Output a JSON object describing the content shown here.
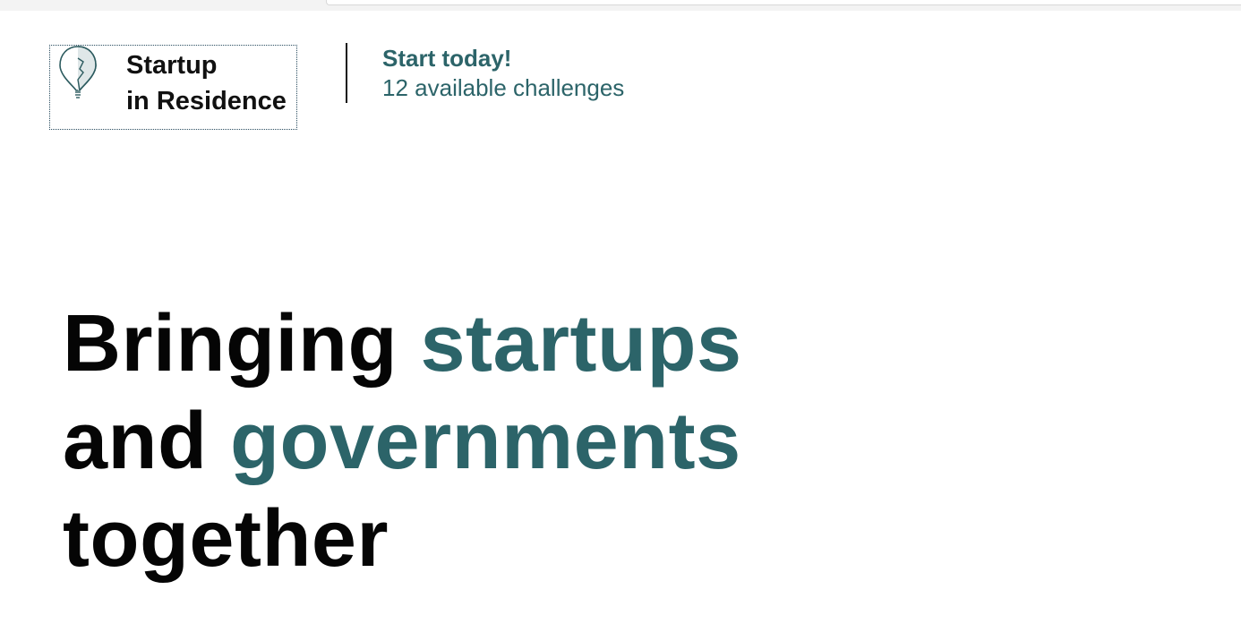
{
  "brand": {
    "line1": "Startup",
    "line2": "in Residence",
    "logo_icon": "lightbulb-icon"
  },
  "cta": {
    "title": "Start today!",
    "subtitle": "12 available challenges"
  },
  "hero": {
    "word1": "Bringing",
    "word2": "startups",
    "word3": "and",
    "word4": "governments",
    "word5": "together"
  },
  "colors": {
    "accent": "#2c6469",
    "text": "#050505",
    "background": "#ffffff"
  }
}
